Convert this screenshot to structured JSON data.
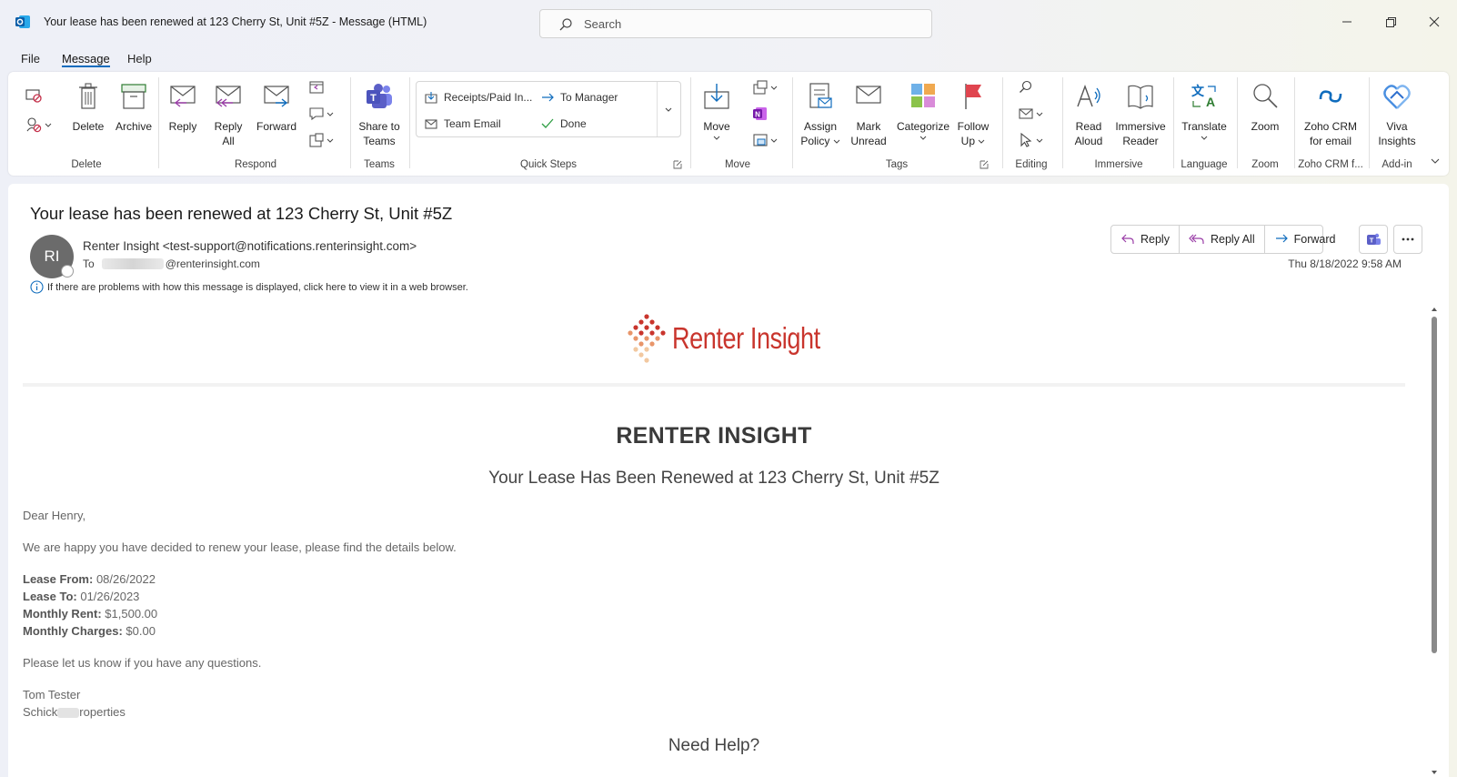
{
  "window": {
    "title": "Your lease has been renewed at 123 Cherry St, Unit #5Z  -  Message (HTML)",
    "search_placeholder": "Search"
  },
  "menu": {
    "file": "File",
    "message": "Message",
    "help": "Help"
  },
  "ribbon": {
    "delete": "Delete",
    "archive": "Archive",
    "group_delete": "Delete",
    "reply": "Reply",
    "reply_all_1": "Reply",
    "reply_all_2": "All",
    "forward": "Forward",
    "group_respond": "Respond",
    "share_teams_1": "Share to",
    "share_teams_2": "Teams",
    "group_teams": "Teams",
    "qs_receipts": "Receipts/Paid In...",
    "qs_to_manager": "To Manager",
    "qs_team_email": "Team Email",
    "qs_done": "Done",
    "group_quick_steps": "Quick Steps",
    "move": "Move",
    "group_move": "Move",
    "assign_policy_1": "Assign",
    "assign_policy_2": "Policy",
    "mark_unread_1": "Mark",
    "mark_unread_2": "Unread",
    "categorize": "Categorize",
    "follow_up_1": "Follow",
    "follow_up_2": "Up",
    "group_tags": "Tags",
    "group_editing": "Editing",
    "read_aloud_1": "Read",
    "read_aloud_2": "Aloud",
    "immersive_reader_1": "Immersive",
    "immersive_reader_2": "Reader",
    "group_immersive": "Immersive",
    "translate": "Translate",
    "group_language": "Language",
    "zoom": "Zoom",
    "group_zoom": "Zoom",
    "zoho_1": "Zoho CRM",
    "zoho_2": "for email",
    "group_zoho": "Zoho CRM f...",
    "viva_1": "Viva",
    "viva_2": "Insights",
    "group_addin": "Add-in"
  },
  "message": {
    "subject": "Your lease has been renewed at 123 Cherry St, Unit #5Z",
    "avatar_initials": "RI",
    "sender": "Renter Insight <test-support@notifications.renterinsight.com>",
    "to_label": "To",
    "to_domain": "@renterinsight.com",
    "info": "If there are problems with how this message is displayed, click here to view it in a web browser.",
    "date": "Thu 8/18/2022 9:58 AM",
    "btn_reply": "Reply",
    "btn_reply_all": "Reply All",
    "btn_forward": "Forward"
  },
  "email": {
    "logo_text": "Renter Insight",
    "brand_heading": "RENTER INSIGHT",
    "lease_heading": "Your Lease Has Been Renewed at 123 Cherry St, Unit #5Z",
    "greeting": "Dear Henry,",
    "intro": "We are happy you have decided to renew your lease, please find the details below.",
    "lease_from_label": "Lease From:",
    "lease_from": "08/26/2022",
    "lease_to_label": "Lease To:",
    "lease_to": "01/26/2023",
    "monthly_rent_label": "Monthly Rent:",
    "monthly_rent": "$1,500.00",
    "monthly_charges_label": "Monthly Charges:",
    "monthly_charges": "$0.00",
    "questions": "Please let us know if you have any questions.",
    "sig_name": "Tom Tester",
    "sig_company_prefix": "Schick",
    "sig_company_suffix": "roperties",
    "need_help": "Need Help?"
  },
  "colors": {
    "accent": "#0f6cbd",
    "brand_red": "#c9352d",
    "teams_purple": "#5b5fc7"
  }
}
